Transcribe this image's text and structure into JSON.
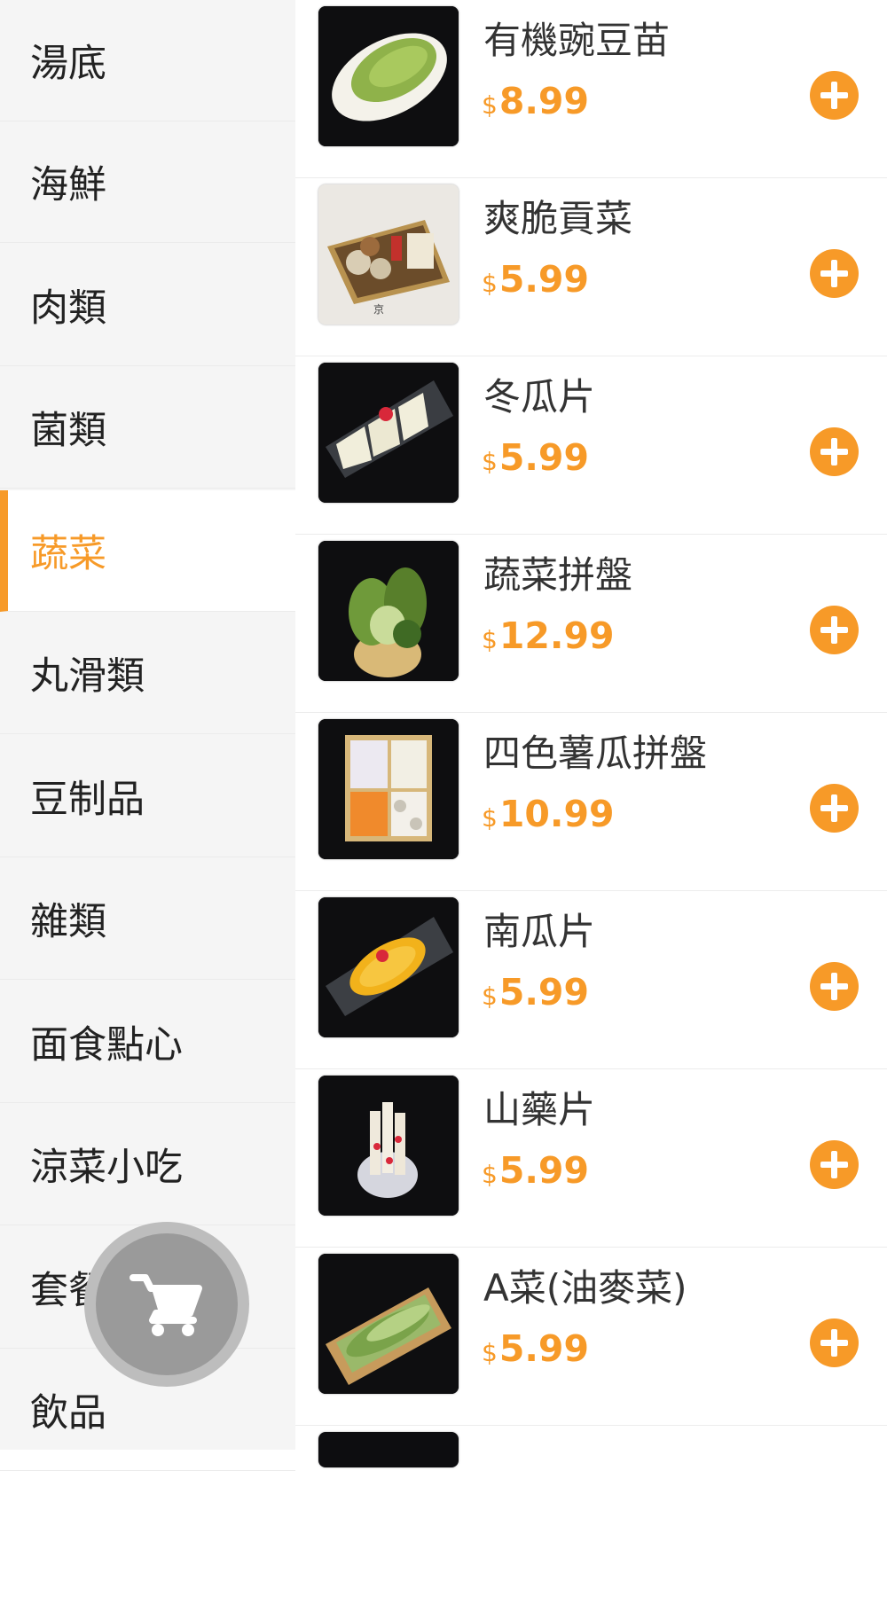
{
  "sidebar": {
    "categories": [
      {
        "label": "湯底"
      },
      {
        "label": "海鮮"
      },
      {
        "label": "肉類"
      },
      {
        "label": "菌類"
      },
      {
        "label": "蔬菜"
      },
      {
        "label": "丸滑類"
      },
      {
        "label": "豆制品"
      },
      {
        "label": "雜類"
      },
      {
        "label": "面食點心"
      },
      {
        "label": "涼菜小吃"
      },
      {
        "label": "套餐"
      },
      {
        "label": "飲品"
      }
    ],
    "active": "蔬菜"
  },
  "products": [
    {
      "name": "有機豌豆苗",
      "currency": "$",
      "price": "8.99"
    },
    {
      "name": "爽脆貢菜",
      "currency": "$",
      "price": "5.99"
    },
    {
      "name": "冬瓜片",
      "currency": "$",
      "price": "5.99"
    },
    {
      "name": "蔬菜拼盤",
      "currency": "$",
      "price": "12.99"
    },
    {
      "name": "四色薯瓜拼盤",
      "currency": "$",
      "price": "10.99"
    },
    {
      "name": "南瓜片",
      "currency": "$",
      "price": "5.99"
    },
    {
      "name": "山藥片",
      "currency": "$",
      "price": "5.99"
    },
    {
      "name": "A菜(油麥菜)",
      "currency": "$",
      "price": "5.99"
    }
  ],
  "colors": {
    "accent": "#f79a28",
    "sidebar_bg": "#f5f5f5",
    "cart_button": "#9a9a9a"
  },
  "icons": {
    "add": "plus-circle-icon",
    "cart": "shopping-cart-icon"
  }
}
